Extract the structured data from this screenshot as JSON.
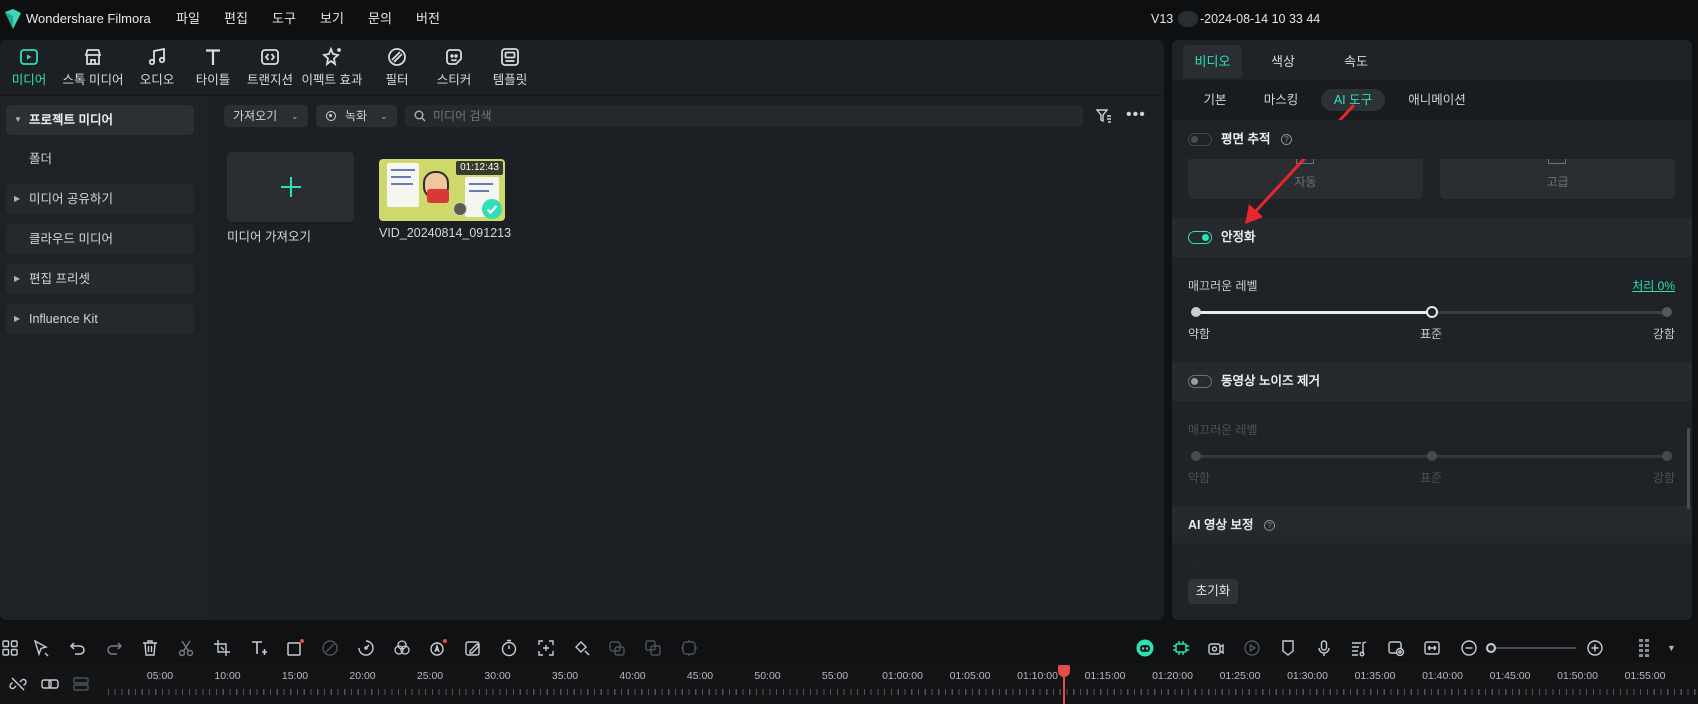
{
  "app": {
    "name": "Wondershare Filmora",
    "version_prefix": "V13",
    "version_date": "-2024-08-14 10 33 44",
    "accent": "#2fe0b5"
  },
  "menu": {
    "items": [
      {
        "label": "파일"
      },
      {
        "label": "편집"
      },
      {
        "label": "도구"
      },
      {
        "label": "보기"
      },
      {
        "label": "문의"
      },
      {
        "label": "버전"
      }
    ]
  },
  "toolbar": {
    "items": [
      {
        "label": "미디어",
        "icon": "media-icon",
        "active": true
      },
      {
        "label": "스톡 미디어",
        "icon": "stock-media-icon"
      },
      {
        "label": "오디오",
        "icon": "audio-icon"
      },
      {
        "label": "타이틀",
        "icon": "title-icon"
      },
      {
        "label": "트랜지션",
        "icon": "transition-icon"
      },
      {
        "label": "이펙트 효과",
        "icon": "effects-icon"
      },
      {
        "label": "필터",
        "icon": "filter-icon"
      },
      {
        "label": "스티커",
        "icon": "sticker-icon"
      },
      {
        "label": "템플릿",
        "icon": "template-icon"
      }
    ]
  },
  "sidebar": {
    "items": [
      {
        "label": "프로젝트 미디어",
        "expanded": true
      },
      {
        "label": "폴더"
      },
      {
        "label": "미디어 공유하기"
      },
      {
        "label": "클라우드 미디어"
      },
      {
        "label": "편집 프리셋"
      },
      {
        "label": "Influence Kit"
      }
    ]
  },
  "media": {
    "import_label": "가져오기",
    "record_label": "녹화",
    "search_placeholder": "미디어 검색",
    "items": [
      {
        "name": "미디어 가져오기"
      },
      {
        "name": "VID_20240814_091213",
        "duration": "01:12:43",
        "selected": true
      }
    ]
  },
  "inspector": {
    "tabs": [
      {
        "label": "비디오",
        "active": true
      },
      {
        "label": "색상"
      },
      {
        "label": "속도"
      }
    ],
    "subtabs": [
      {
        "label": "기본"
      },
      {
        "label": "마스킹"
      },
      {
        "label": "AI 도구",
        "active": true
      },
      {
        "label": "애니메이션"
      }
    ],
    "planar_tracking": {
      "title": "평면 추적",
      "enabled": false,
      "auto_label": "자동",
      "advanced_label": "고급"
    },
    "stabilization": {
      "title": "안정화",
      "enabled": true,
      "level_label": "매끄러운 레벨",
      "status": "처리 0%",
      "level": 0.5,
      "min_label": "약함",
      "mid_label": "표준",
      "max_label": "강함"
    },
    "denoise": {
      "title": "동영상 노이즈 제거",
      "enabled": false,
      "level_label": "매끄러운 레벨",
      "level": 0.5,
      "min_label": "약함",
      "mid_label": "표준",
      "max_label": "강함"
    },
    "ai_enhance": {
      "title": "AI 영상 보정"
    },
    "reset_label": "초기화"
  },
  "timeline": {
    "ruler": [
      "05:00",
      "10:00",
      "15:00",
      "20:00",
      "25:00",
      "30:00",
      "35:00",
      "40:00",
      "45:00",
      "50:00",
      "55:00",
      "01:00:00",
      "01:05:00",
      "01:10:00",
      "01:15:00",
      "01:20:00",
      "01:25:00",
      "01:30:00",
      "01:35:00",
      "01:40:00",
      "01:45:00",
      "01:50:00",
      "01:55:00"
    ]
  }
}
